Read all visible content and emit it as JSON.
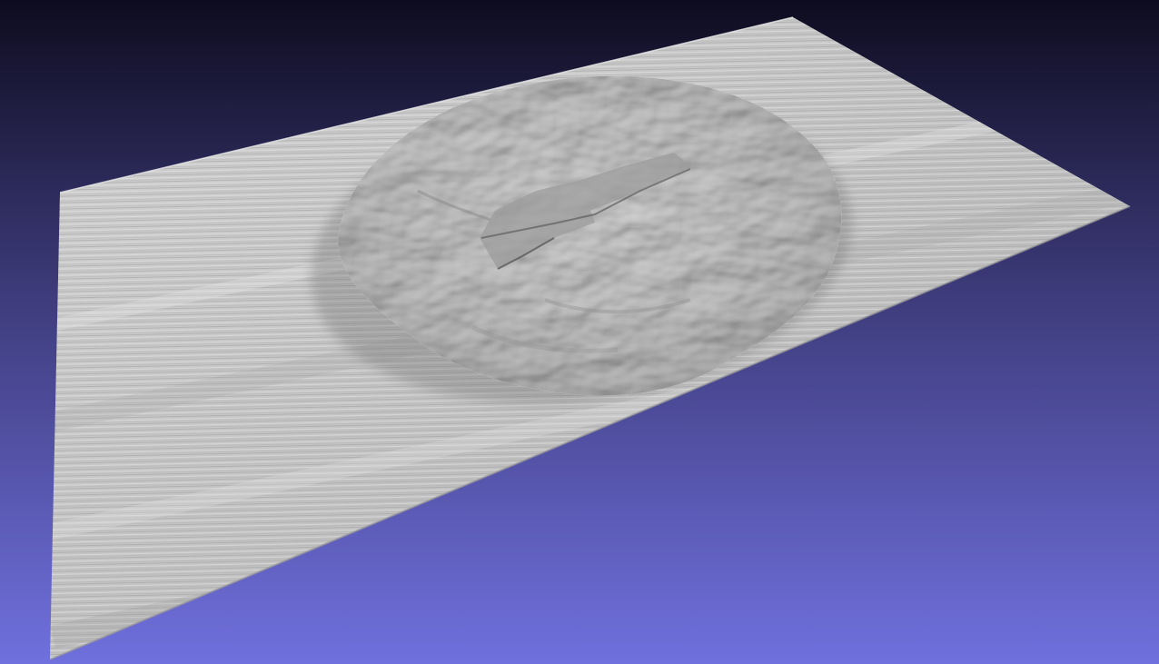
{
  "viewer": {
    "background_top": "#0e0c1f",
    "background_mid": "#3e3c7c",
    "background_bottom": "#7070de",
    "mesh_color": "#c6c6c6",
    "mesh_shadow": "#8c8c8c",
    "mesh_highlight": "#ececec"
  }
}
